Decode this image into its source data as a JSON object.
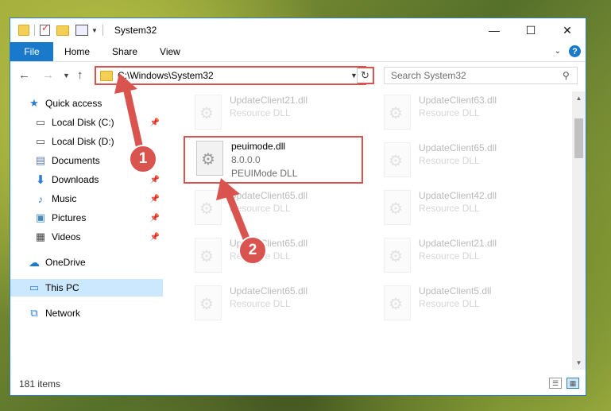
{
  "window": {
    "title": "System32"
  },
  "ribbon": {
    "tabs": [
      "File",
      "Home",
      "Share",
      "View"
    ],
    "help": "?"
  },
  "address": {
    "path": "C:\\Windows\\System32"
  },
  "search": {
    "placeholder": "Search System32"
  },
  "sidebar": {
    "items": [
      {
        "label": "Quick access",
        "icon": "star-icon"
      },
      {
        "label": "Local Disk (C:)",
        "icon": "drive-icon"
      },
      {
        "label": "Local Disk (D:)",
        "icon": "drive-icon"
      },
      {
        "label": "Documents",
        "icon": "document-icon"
      },
      {
        "label": "Downloads",
        "icon": "download-icon"
      },
      {
        "label": "Music",
        "icon": "music-icon"
      },
      {
        "label": "Pictures",
        "icon": "picture-icon"
      },
      {
        "label": "Videos",
        "icon": "video-icon"
      },
      {
        "label": "OneDrive",
        "icon": "cloud-icon"
      },
      {
        "label": "This PC",
        "icon": "computer-icon"
      },
      {
        "label": "Network",
        "icon": "network-icon"
      }
    ]
  },
  "files": [
    {
      "name": "UpdateClient21.dll",
      "line2": "Resource DLL",
      "line3": ""
    },
    {
      "name": "UpdateClient63.dll",
      "line2": "Resource DLL",
      "line3": ""
    },
    {
      "name": "peuimode.dll",
      "line2": "8.0.0.0",
      "line3": "PEUIMode DLL"
    },
    {
      "name": "UpdateClient65.dll",
      "line2": "Resource DLL",
      "line3": ""
    },
    {
      "name": "UpdateClient65.dll",
      "line2": "Resource DLL",
      "line3": ""
    },
    {
      "name": "UpdateClient42.dll",
      "line2": "Resource DLL",
      "line3": ""
    },
    {
      "name": "UpdateClient65.dll",
      "line2": "Resource DLL",
      "line3": ""
    },
    {
      "name": "UpdateClient21.dll",
      "line2": "Resource DLL",
      "line3": ""
    },
    {
      "name": "UpdateClient65.dll",
      "line2": "Resource DLL",
      "line3": ""
    },
    {
      "name": "UpdateClient5.dll",
      "line2": "Resource DLL",
      "line3": ""
    }
  ],
  "status": {
    "count": "181 items"
  },
  "annotations": {
    "step1": "1",
    "step2": "2"
  },
  "colors": {
    "accent": "#1979ca",
    "highlight": "#d9534f"
  }
}
